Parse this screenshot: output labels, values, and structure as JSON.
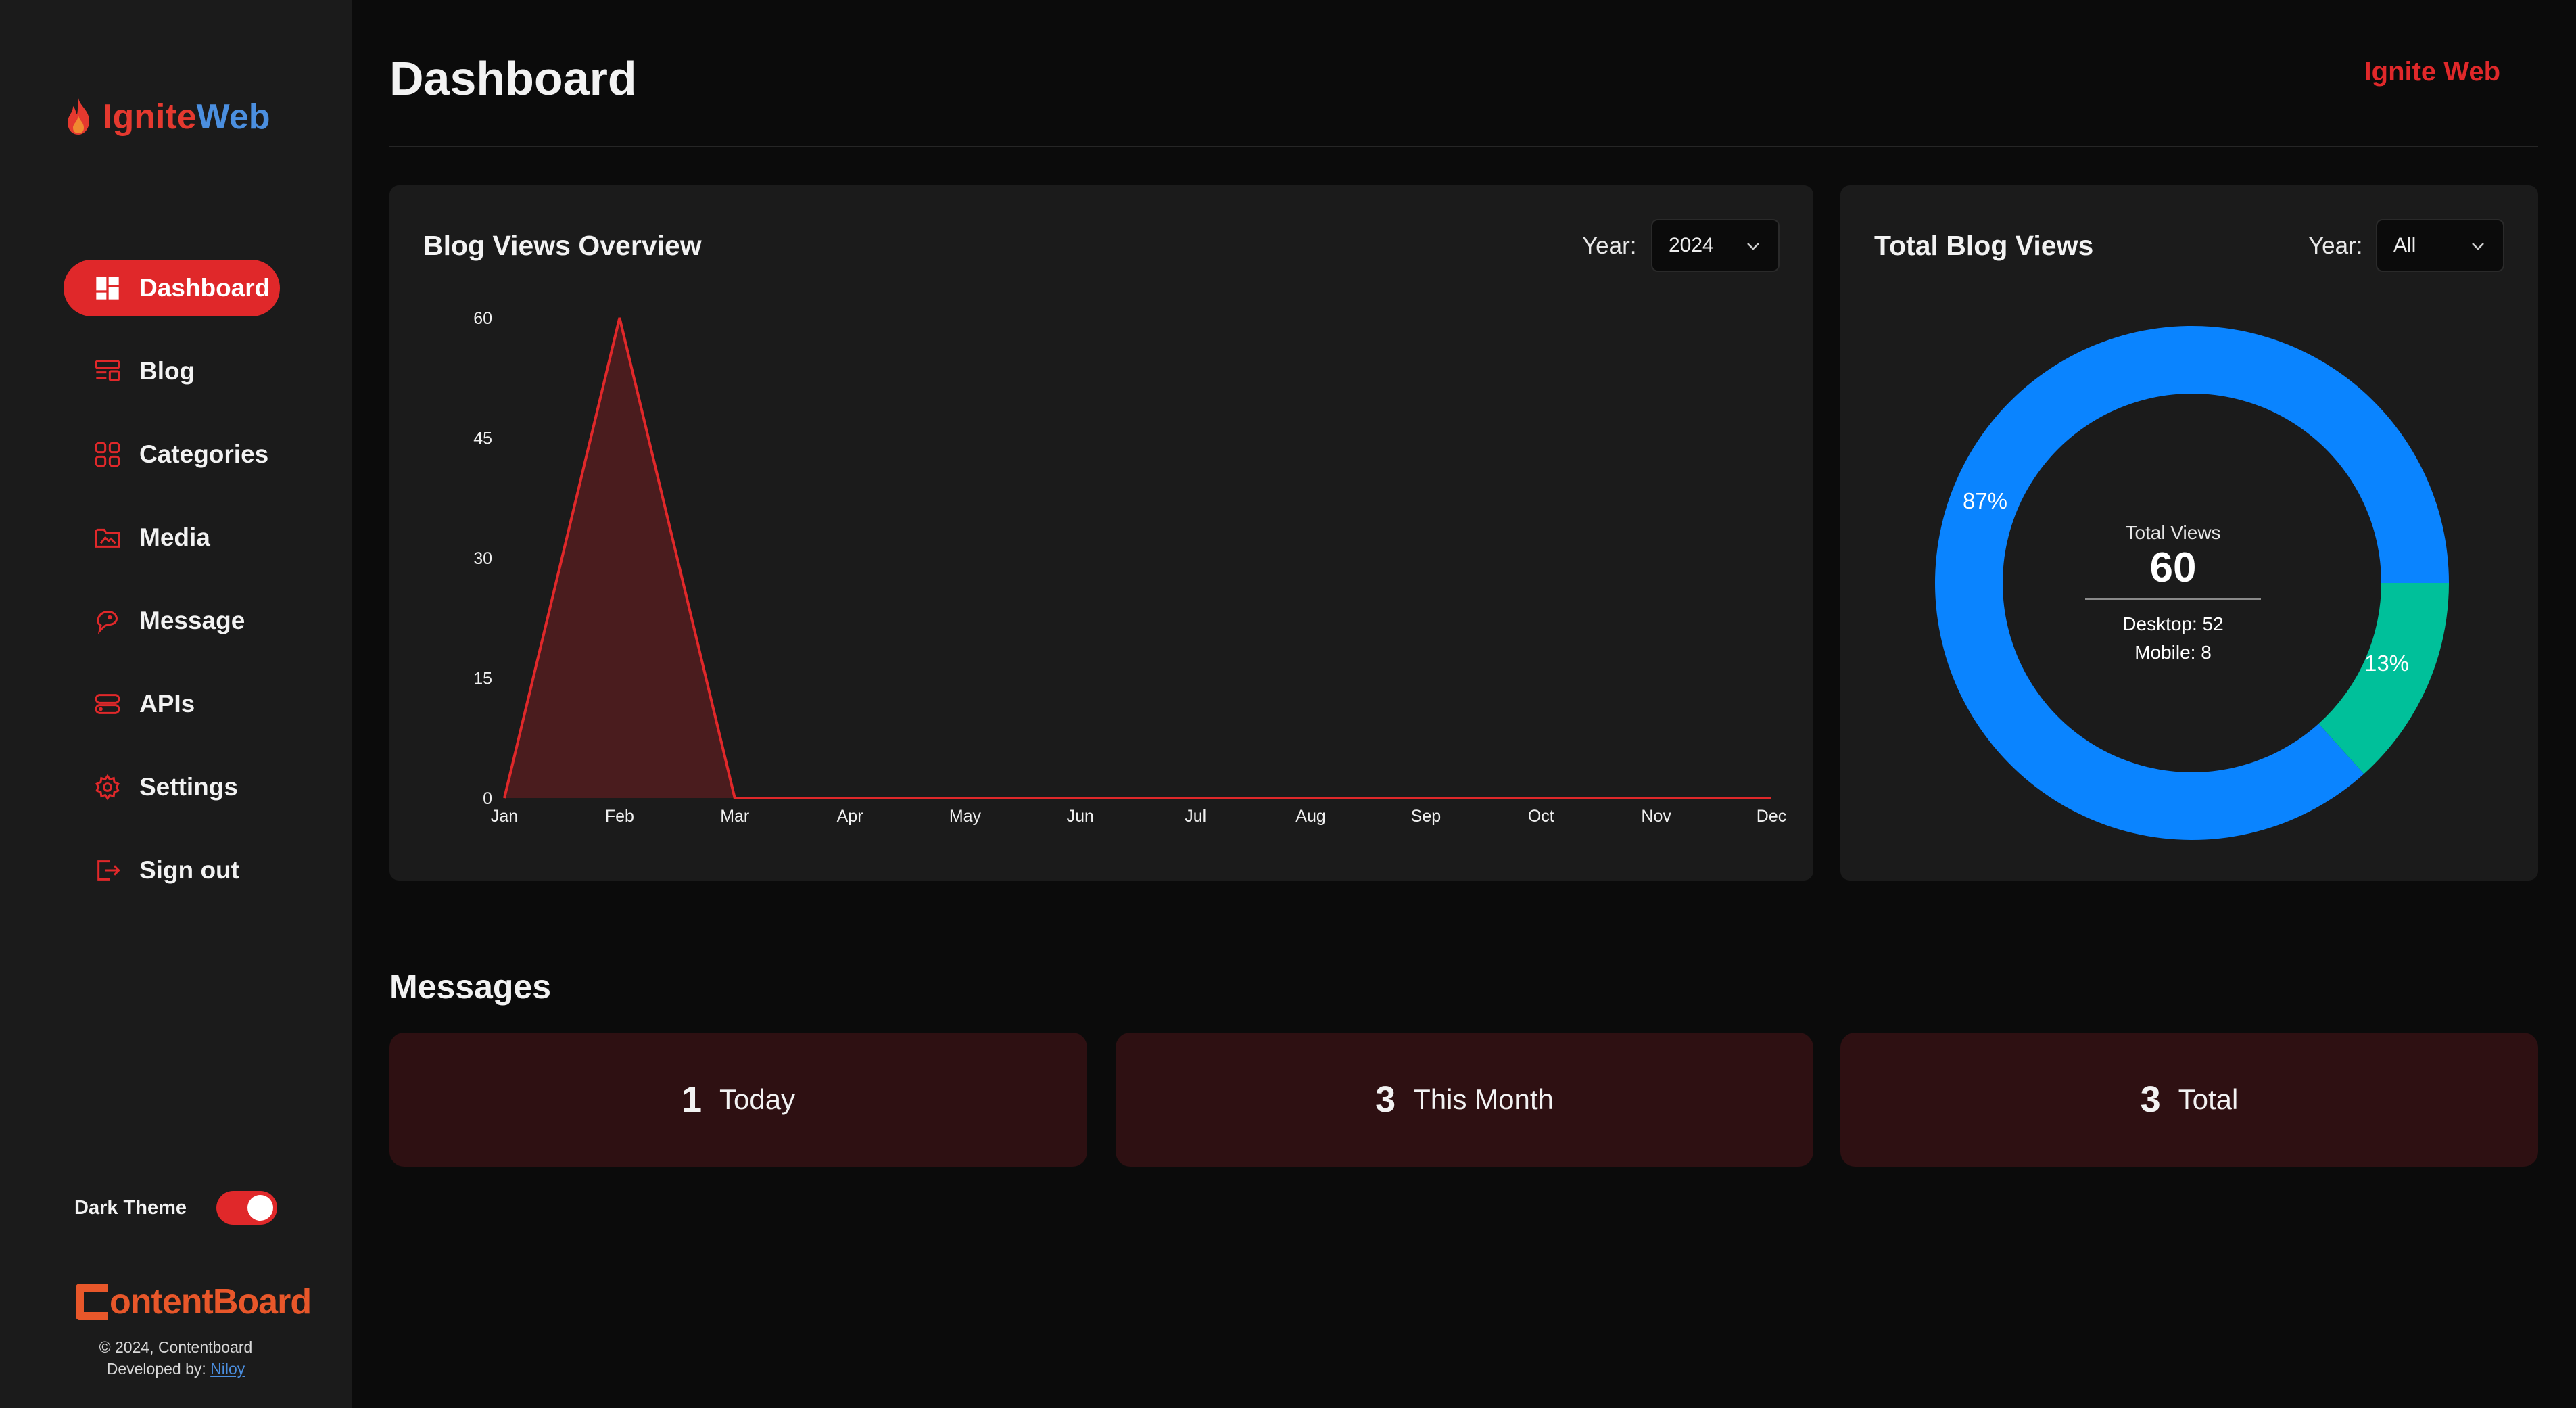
{
  "sidebar": {
    "brand": {
      "part1": "Ignite",
      "part2": "Web"
    },
    "items": [
      {
        "label": "Dashboard",
        "icon": "dashboard-icon",
        "active": true
      },
      {
        "label": "Blog",
        "icon": "blog-icon"
      },
      {
        "label": "Categories",
        "icon": "categories-icon"
      },
      {
        "label": "Media",
        "icon": "media-icon"
      },
      {
        "label": "Message",
        "icon": "message-icon"
      },
      {
        "label": "APIs",
        "icon": "apis-icon"
      },
      {
        "label": "Settings",
        "icon": "gear-icon"
      },
      {
        "label": "Sign out",
        "icon": "sign-out-icon"
      }
    ],
    "theme_label": "Dark Theme",
    "theme_on": true,
    "footer_logo": "ontentBoard",
    "copyright": "© 2024, Contentboard",
    "developed_by": "Developed by:",
    "developer": "Niloy"
  },
  "header": {
    "title": "Dashboard",
    "brand_link": "Ignite Web"
  },
  "colors": {
    "accent": "#e0282a",
    "desktop": "#0a84ff",
    "mobile": "#00c09a",
    "message_card": "#2e1012"
  },
  "views_card": {
    "title": "Blog Views Overview",
    "year_label": "Year:",
    "year_value": "2024"
  },
  "total_card": {
    "title": "Total Blog Views",
    "year_label": "Year:",
    "year_value": "All",
    "center_title": "Total Views",
    "center_value": "60",
    "desktop_text": "Desktop: 52",
    "mobile_text": "Mobile: 8",
    "desktop_pct": "87%",
    "mobile_pct": "13%"
  },
  "chart_data": [
    {
      "type": "area",
      "categories": [
        "Jan",
        "Feb",
        "Mar",
        "Apr",
        "May",
        "Jun",
        "Jul",
        "Aug",
        "Sep",
        "Oct",
        "Nov",
        "Dec"
      ],
      "values": [
        0,
        60,
        0,
        0,
        0,
        0,
        0,
        0,
        0,
        0,
        0,
        0
      ],
      "yticks": [
        "0",
        "15",
        "30",
        "45",
        "60"
      ],
      "ylim": [
        0,
        60
      ],
      "grid": false,
      "color": "#e0282a"
    },
    {
      "type": "pie",
      "categories": [
        "Desktop",
        "Mobile"
      ],
      "values": [
        52,
        8
      ],
      "labels": [
        "87%",
        "13%"
      ],
      "donut": true
    }
  ],
  "messages": {
    "title": "Messages",
    "cards": [
      {
        "count": "1",
        "label": "Today"
      },
      {
        "count": "3",
        "label": "This Month"
      },
      {
        "count": "3",
        "label": "Total"
      }
    ]
  }
}
